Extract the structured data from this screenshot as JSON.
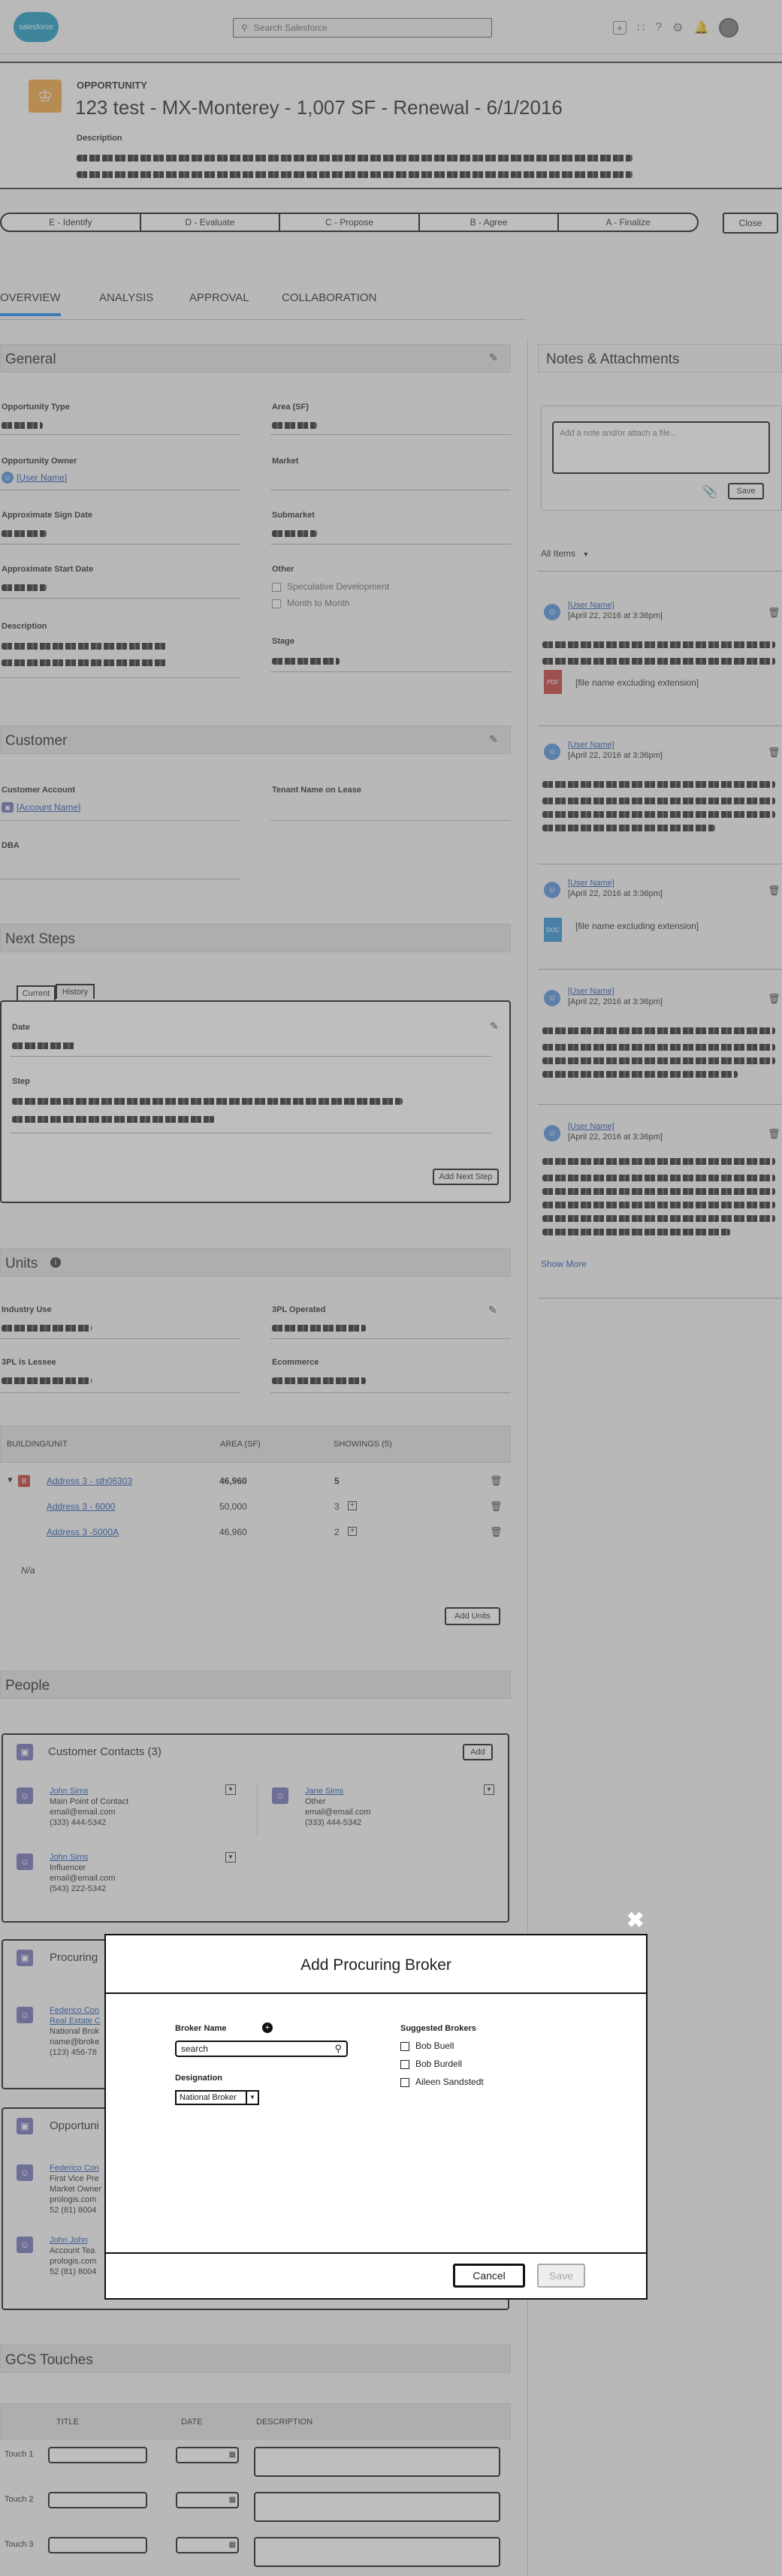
{
  "header": {
    "logo_text": "salesforce",
    "search_placeholder": "Search Salesforce",
    "icons": [
      "plus-icon",
      "grid-icon",
      "help-icon",
      "gear-icon",
      "bell-icon",
      "avatar-icon"
    ]
  },
  "record": {
    "object_label": "OPPORTUNITY",
    "title": "123 test - MX-Monterey - 1,007 SF - Renewal - 6/1/2016",
    "description_label": "Description"
  },
  "path": {
    "stages": [
      "E - Identify",
      "D - Evaluate",
      "C - Propose",
      "B - Agree",
      "A - Finalize"
    ],
    "close_label": "Close"
  },
  "tabs": [
    "OVERVIEW",
    "ANALYSIS",
    "APPROVAL",
    "COLLABORATION"
  ],
  "general": {
    "title": "General",
    "opportunity_type": "Opportunity Type",
    "area": "Area (SF)",
    "opportunity_owner": "Opportunity Owner",
    "owner_value": "[User Name]",
    "market": "Market",
    "sign_date": "Approximate Sign Date",
    "submarket": "Submarket",
    "start_date": "Approximate Start Date",
    "other": "Other",
    "speculative": "Speculative Development",
    "month_to_month": "Month to Month",
    "description": "Description",
    "stage": "Stage"
  },
  "customer": {
    "title": "Customer",
    "account_label": "Customer Account",
    "account_value": "[Account Name]",
    "tenant_label": "Tenant Name on Lease",
    "dba_label": "DBA"
  },
  "next_steps": {
    "title": "Next Steps",
    "tab_current": "Current",
    "tab_history": "History",
    "date_label": "Date",
    "step_label": "Step",
    "add_button": "Add Next Step"
  },
  "units": {
    "title": "Units",
    "industry_use": "Industry Use",
    "three_pl_operated": "3PL Operated",
    "three_pl_lessee": "3PL is Lessee",
    "ecommerce": "Ecommerce",
    "columns": [
      "BUILDING/UNIT",
      "AREA (SF)",
      "SHOWINGS (5)"
    ],
    "rows": [
      {
        "name": "Address 3 - sth06303",
        "area": "46,960",
        "showings": "5"
      },
      {
        "name": "Address 3 - 6000",
        "area": "50,000",
        "showings": "3"
      },
      {
        "name": "Address 3 -5000A",
        "area": "46,960",
        "showings": "2"
      }
    ],
    "na": "N/a",
    "add_button": "Add Units"
  },
  "people": {
    "title": "People",
    "customer_contacts_title": "Customer Contacts (3)",
    "add_button": "Add",
    "contacts": [
      {
        "name": "John Sims",
        "role": "Main Point of Contact",
        "email": "email@email.com",
        "phone": "(333) 444-5342"
      },
      {
        "name": "Jane Sims",
        "role": "Other",
        "email": "email@email.com",
        "phone": "(333) 444-5342"
      },
      {
        "name": "John Sims",
        "role": "Influencer",
        "email": "email@email.com",
        "phone": "(543) 222-5342"
      }
    ],
    "procuring_title": "Procuring",
    "procuring_contact": {
      "name": "Federico Con",
      "company": "Real Estate C",
      "role": "National Brok",
      "email": "name@broke",
      "phone": "(123) 456-78"
    },
    "opportunity_title": "Opportuni",
    "opp_contacts": [
      {
        "name": "Federico Con",
        "role": "First Vice Pre",
        "role2": "Market Owner",
        "email": "prologis.com",
        "phone": "52 (81) 8004"
      },
      {
        "name": "John John",
        "role": "Account Tea",
        "email": "prologis.com",
        "phone": "52 (81) 8004"
      }
    ]
  },
  "gcs": {
    "title": "GCS Touches",
    "columns": [
      "TITLE",
      "DATE",
      "DESCRIPTION"
    ],
    "rows": [
      "Touch 1",
      "Touch 2",
      "Touch 3"
    ]
  },
  "notes": {
    "title": "Notes & Attachments",
    "placeholder": "Add a note and/or attach a file...",
    "save": "Save",
    "filter": "All Items",
    "user": "[User Name]",
    "date": "[April 22, 2016 at 3:36pm]",
    "file_name": "[file name excluding extension]",
    "show_more": "Show More"
  },
  "modal": {
    "title": "Add Procuring Broker",
    "broker_name_label": "Broker Name",
    "search_value": "search",
    "designation_label": "Designation",
    "designation_value": "National Broker",
    "suggested_label": "Suggested Brokers",
    "suggested": [
      "Bob Buell",
      "Bob Burdell",
      "Aileen Sandstedt"
    ],
    "cancel": "Cancel",
    "save": "Save"
  },
  "colors": {
    "link": "#1a4fb0",
    "overview_tab_accent": "#1589ee",
    "record_icon": "#f2a53b",
    "avatar": "#6d6db8",
    "user_avatar": "#4d8ed9",
    "pdf_icon": "#c23934",
    "doc_icon": "#2a8fd8"
  }
}
